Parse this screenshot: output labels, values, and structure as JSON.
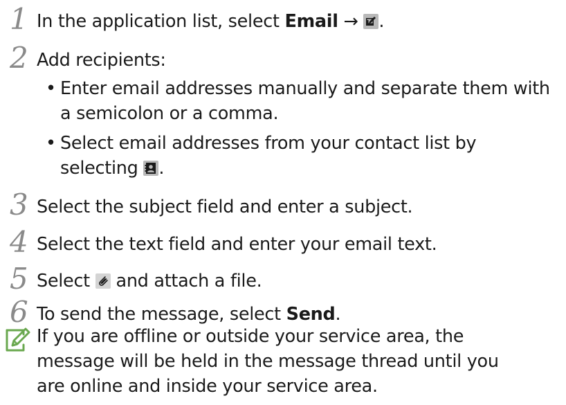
{
  "steps": [
    {
      "num": "1",
      "before": "In the application list, select ",
      "bold": "Email",
      "after": " → ",
      "end": "."
    },
    {
      "num": "2",
      "text": "Add recipients:"
    },
    {
      "num": "3",
      "text": "Select the subject field and enter a subject."
    },
    {
      "num": "4",
      "text": "Select the text field and enter your email text."
    },
    {
      "num": "5",
      "before": "Select ",
      "after": " and attach a file."
    },
    {
      "num": "6",
      "before": "To send the message, select ",
      "bold": "Send",
      "end": "."
    }
  ],
  "bullets": [
    {
      "dot": "•",
      "line1": "Enter email addresses manually and separate them with",
      "line2": "a semicolon or a comma."
    },
    {
      "dot": "•",
      "line1": "Select email addresses from your contact list by",
      "line2_before": "selecting ",
      "line2_end": "."
    }
  ],
  "icons": {
    "compose": "compose-icon",
    "contacts": "contacts-icon",
    "attach": "paperclip-icon",
    "note": "note-pencil-icon"
  },
  "note": {
    "line1": "If you are offline or outside your service area, the",
    "line2": "message will be held in the message thread until you",
    "line3": "are online and inside your service area."
  },
  "colors": {
    "text": "#1a1a1a",
    "step_number": "#8a8a8a",
    "icon_bg": "#b9b9b9",
    "note_icon": "#6aa84f"
  }
}
